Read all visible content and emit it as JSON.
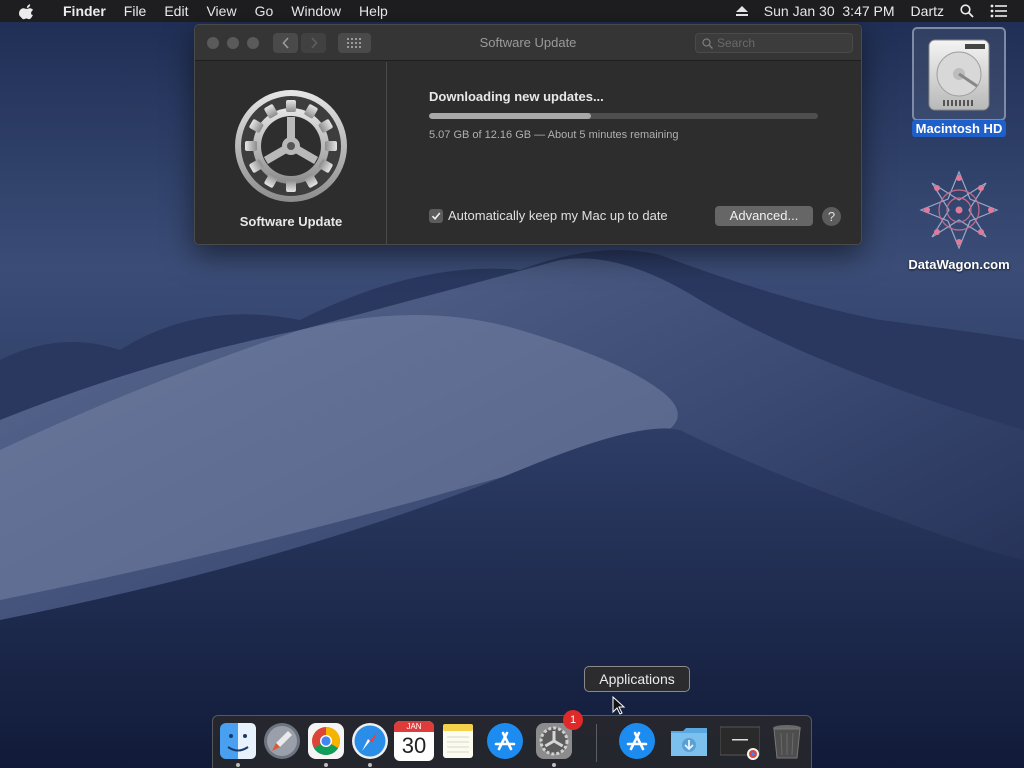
{
  "menubar": {
    "app_name": "Finder",
    "items": [
      "File",
      "Edit",
      "View",
      "Go",
      "Window",
      "Help"
    ],
    "datetime": "Sun Jan 30  3:47 PM",
    "user": "Dartz"
  },
  "window": {
    "title": "Software Update",
    "search_placeholder": "Search",
    "pane_title": "Software Update",
    "status_title": "Downloading new updates...",
    "status_detail": "5.07 GB of 12.16 GB — About 5 minutes remaining",
    "progress_fraction": 0.417,
    "auto_update_label": "Automatically keep my Mac up to date",
    "auto_update_checked": true,
    "advanced_label": "Advanced...",
    "help_label": "?"
  },
  "desktop": {
    "icons": [
      {
        "label": "Macintosh HD",
        "icon": "hard-drive-icon",
        "selected": true
      },
      {
        "label": "DataWagon.com",
        "icon": "datawagon-logo-icon",
        "selected": false
      }
    ]
  },
  "tooltip": "Applications",
  "dock": {
    "items": [
      {
        "name": "finder",
        "icon": "finder-icon",
        "running": true
      },
      {
        "name": "launchpad",
        "icon": "launchpad-icon",
        "running": false
      },
      {
        "name": "chrome",
        "icon": "chrome-icon",
        "running": true
      },
      {
        "name": "safari",
        "icon": "safari-icon",
        "running": true
      },
      {
        "name": "calendar",
        "icon": "calendar-icon",
        "running": false,
        "month": "JAN",
        "day": "30"
      },
      {
        "name": "notes",
        "icon": "notes-icon",
        "running": false
      },
      {
        "name": "app-store",
        "icon": "app-store-icon",
        "running": false
      },
      {
        "name": "system-preferences",
        "icon": "gear-icon",
        "running": true,
        "badge": "1"
      },
      {
        "name": "applications",
        "icon": "applications-folder-icon",
        "running": false
      },
      {
        "name": "downloads",
        "icon": "downloads-folder-icon",
        "running": false
      },
      {
        "name": "window-preview",
        "icon": "window-thumbnail-icon",
        "running": false
      },
      {
        "name": "trash",
        "icon": "trash-icon",
        "running": false
      }
    ]
  },
  "colors": {
    "accent_selected": "#1f5fc9",
    "badge": "#e02a2a",
    "window_bg": "#2d2d2d"
  }
}
